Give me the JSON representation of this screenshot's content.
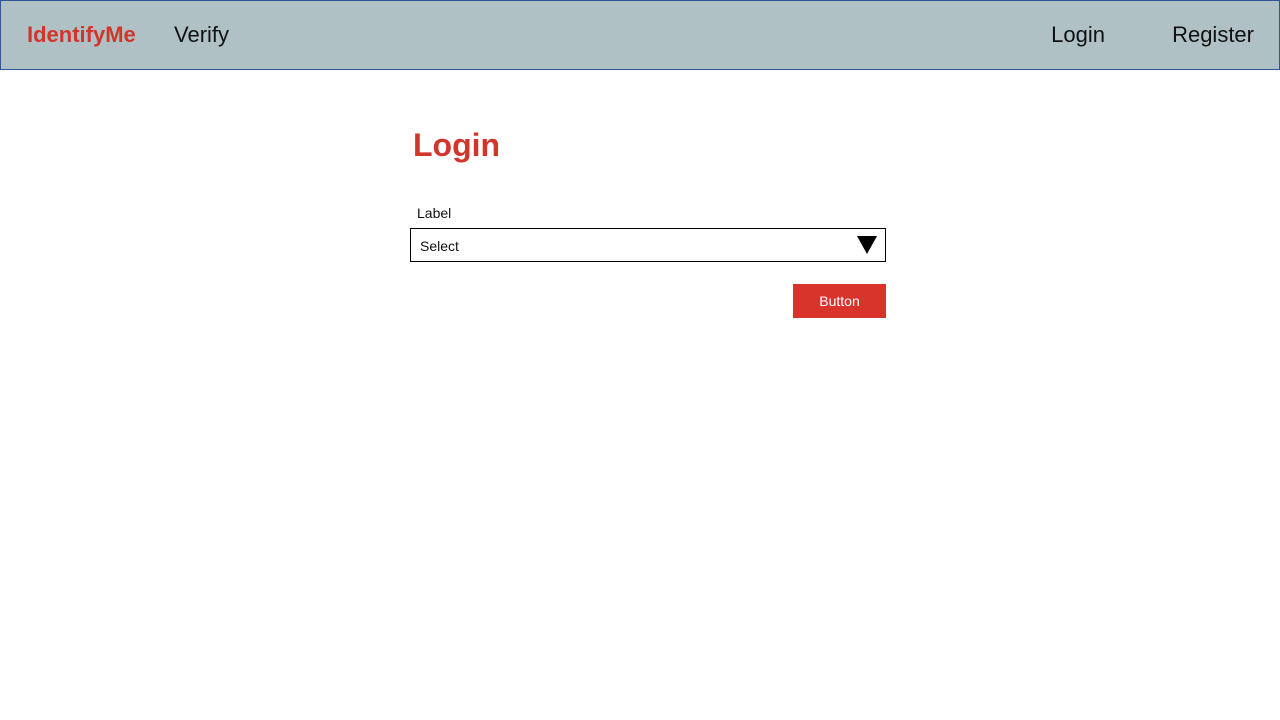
{
  "nav": {
    "brand": "IdentifyMe",
    "links": [
      {
        "label": "Verify"
      },
      {
        "label": "Login"
      },
      {
        "label": "Register"
      }
    ]
  },
  "form": {
    "title": "Login",
    "select": {
      "label": "Label",
      "value": "Select"
    },
    "button_label": "Button"
  },
  "colors": {
    "nav_background": "#b0c1c6",
    "nav_border": "#2f5597",
    "accent": "#d1352b",
    "button": "#d9342b"
  },
  "icons": {
    "select_arrow": "triangle-down-icon"
  }
}
